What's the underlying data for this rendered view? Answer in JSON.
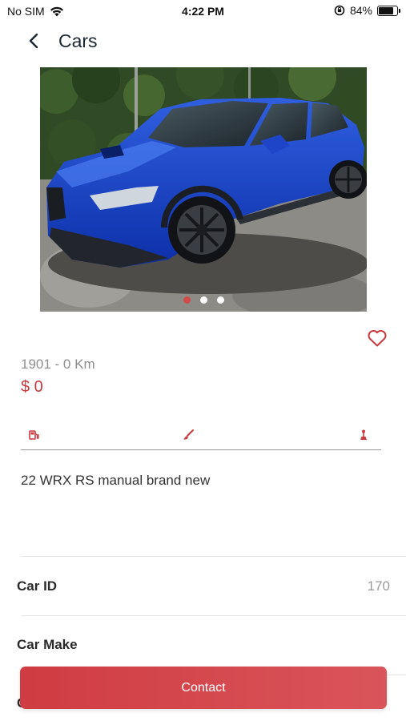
{
  "status_bar": {
    "carrier": "No SIM",
    "time": "4:22 PM",
    "battery": "84%",
    "battery_level": 0.84
  },
  "nav": {
    "title": "Cars",
    "back_icon": "chevron-left-icon"
  },
  "gallery": {
    "image_count": 3,
    "active_index": 0,
    "image_description_icon": "car-photo"
  },
  "listing": {
    "subtitle": "1901 - 0 Km",
    "price": "$ 0",
    "description": "22 WRX RS manual brand new",
    "favorite_icon": "heart-outline-icon"
  },
  "feature_icons": [
    "fuel-pump-icon",
    "paint-brush-icon",
    "gear-shift-icon"
  ],
  "details": [
    {
      "label": "Car ID",
      "value": "170"
    },
    {
      "label": "Car Make",
      "value": ""
    }
  ],
  "partial_row_label": "C",
  "actions": {
    "contact_label": "Contact"
  },
  "colors": {
    "accent": "#c9393f",
    "button": "#d34a4f",
    "text_muted": "#8e8e8e"
  }
}
